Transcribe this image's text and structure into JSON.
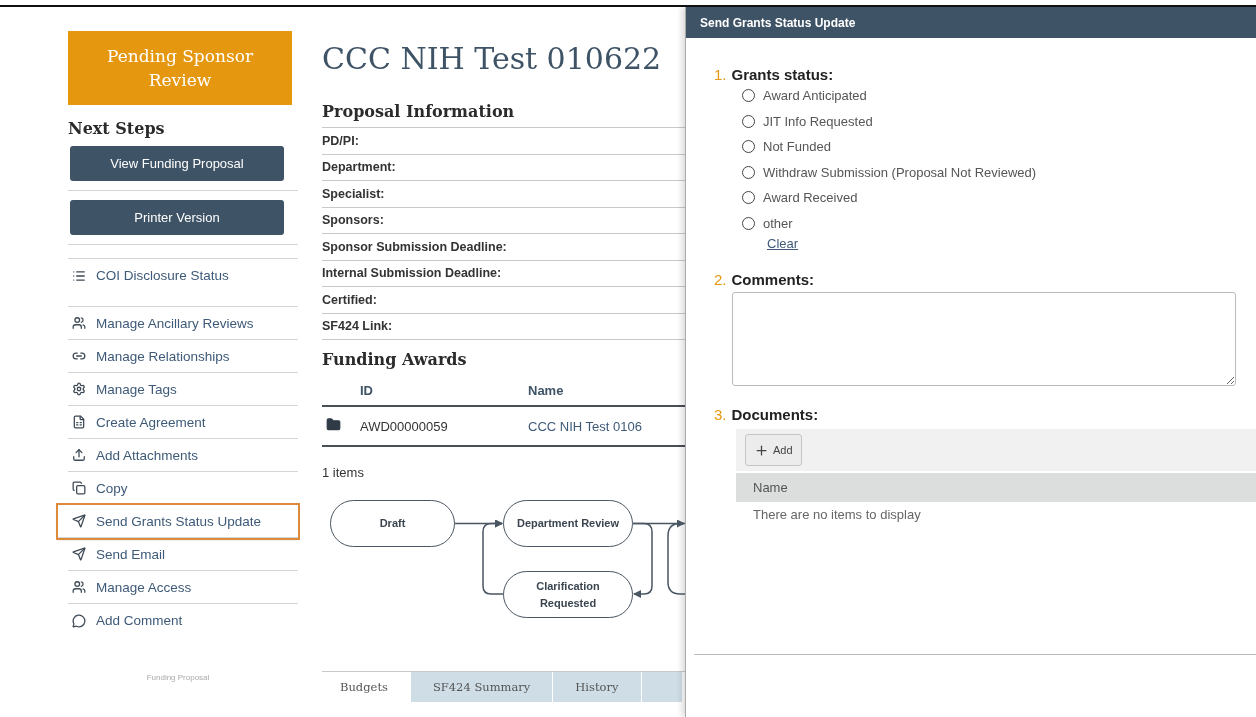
{
  "sidebar": {
    "status": "Pending Sponsor Review",
    "heading": "Next Steps",
    "buttons": [
      "View Funding Proposal",
      "Printer Version"
    ],
    "item_groups": [
      {
        "items": [
          {
            "label": "COI Disclosure Status",
            "selected": false
          }
        ]
      },
      {
        "items": [
          {
            "label": "Manage Ancillary Reviews",
            "selected": false
          },
          {
            "label": "Manage Relationships",
            "selected": false
          },
          {
            "label": "Manage Tags",
            "selected": false
          },
          {
            "label": "Create Agreement",
            "selected": false
          },
          {
            "label": "Add Attachments",
            "selected": false
          },
          {
            "label": "Copy",
            "selected": false
          },
          {
            "label": "Send Grants Status Update",
            "selected": true
          },
          {
            "label": "Send Email",
            "selected": false
          },
          {
            "label": "Manage Access",
            "selected": false
          },
          {
            "label": "Add Comment",
            "selected": false
          }
        ]
      }
    ],
    "footer": "Funding Proposal"
  },
  "main": {
    "title": "CCC NIH Test 010622",
    "proposal_information": {
      "heading": "Proposal Information",
      "fields": [
        "PD/PI:",
        "Department:",
        "Specialist:",
        "Sponsors:",
        "Sponsor Submission Deadline:",
        "Internal Submission Deadline:",
        "Certified:",
        "SF424 Link:"
      ]
    },
    "funding_awards": {
      "heading": "Funding Awards",
      "columns": [
        "ID",
        "Name"
      ],
      "rows": [
        {
          "id": "AWD00000059",
          "name": "CCC NIH Test 0106"
        }
      ],
      "count": "1 items"
    },
    "workflow": {
      "nodes": [
        {
          "label": "Draft"
        },
        {
          "label": "Department Review"
        },
        {
          "label": "Clarification Requested"
        }
      ]
    },
    "tabs": [
      {
        "label": "Budgets",
        "selected": true
      },
      {
        "label": "SF424 Summary",
        "selected": false
      },
      {
        "label": "History",
        "selected": false
      }
    ]
  },
  "dialog": {
    "title": "Send Grants Status Update",
    "questions": [
      {
        "number": "1.",
        "label": "Grants status:",
        "kind": "radio",
        "options": [
          {
            "label": "Award Anticipated",
            "selected": false
          },
          {
            "label": "JIT Info Requested",
            "selected": false
          },
          {
            "label": "Not Funded",
            "selected": false
          },
          {
            "label": "Withdraw Submission (Proposal Not Reviewed)",
            "selected": false
          },
          {
            "label": "Award Received",
            "selected": false
          },
          {
            "label": "other",
            "selected": false
          }
        ],
        "clear": "Clear"
      },
      {
        "number": "2.",
        "label": "Comments:",
        "kind": "textarea"
      },
      {
        "number": "3.",
        "label": "Documents:",
        "kind": "documents",
        "add": "Add",
        "column": "Name",
        "empty": "There are no items to display"
      }
    ]
  }
}
